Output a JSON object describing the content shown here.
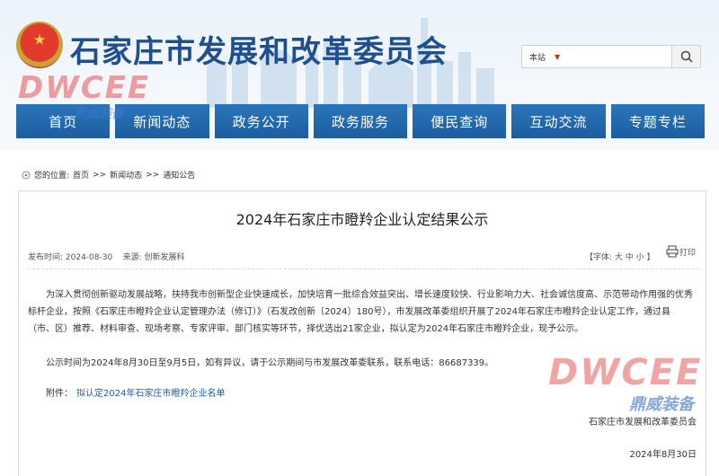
{
  "header": {
    "site_title": "石家庄市发展和改革委员会",
    "search": {
      "scope": "本站",
      "placeholder": ""
    },
    "nav": [
      "首页",
      "新闻动态",
      "政务公开",
      "政务服务",
      "便民查询",
      "互动交流",
      "专题专栏"
    ]
  },
  "watermark": {
    "brand": "DWCEE",
    "cn": "鼎威装备"
  },
  "breadcrumb": {
    "prefix": "您的位置:",
    "items": [
      "首页",
      ">>",
      "新闻动态",
      ">>",
      "通知公告"
    ]
  },
  "article": {
    "title": "2024年石家庄市瞪羚企业认定结果公示",
    "publish_label": "发布时间: 2024-08-30",
    "source_label": "来源: 创新发展科",
    "font_size_label": "【字体: 大 中 小 】",
    "print_label": "打印",
    "paragraphs": [
      "为深入贯彻创新驱动发展战略，扶持我市创新型企业快速成长，加快培育一批综合效益突出、增长速度较快、行业影响力大、社会诚信度高、示范带动作用强的优秀标杆企业，按照《石家庄市瞪羚企业认定管理办法（修订）》（石发改创新〔2024〕180号），市发展改革委组织开展了2024年石家庄市瞪羚企业认定工作，通过县（市、区）推荐、材料审查、现场考察、专家评审、部门核实等环节，择优选出21家企业，拟认定为2024年石家庄市瞪羚企业，现予公示。",
      "公示时间为2024年8月30日至9月5日，如有异议，请于公示期间与市发展改革委联系，联系电话：86687339。"
    ],
    "attachment_label": "附件：",
    "attachment_link": "拟认定2024年石家庄市瞪羚企业名单",
    "org": "石家庄市发展和改革委员会",
    "date": "2024年8月30日"
  },
  "colors": {
    "nav_bg": "#1f63a6",
    "title_blue": "#1f4f8f",
    "link": "#1f5fa8"
  }
}
